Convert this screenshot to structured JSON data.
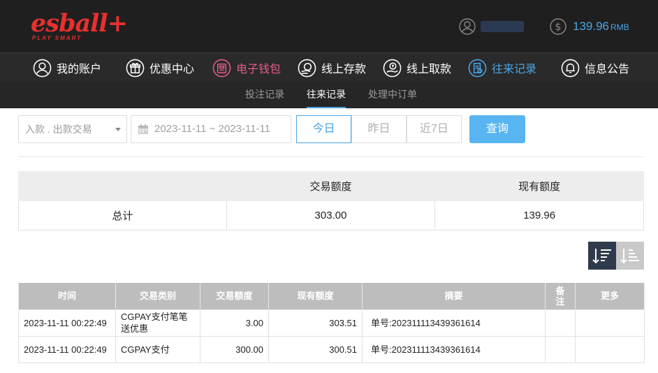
{
  "header": {
    "logo_text": "esball+",
    "logo_tagline": "PLAY SMART",
    "balance_amount": "139.96",
    "balance_unit": "RMB"
  },
  "nav": [
    {
      "label": "我的账户",
      "icon": "user-circle-icon"
    },
    {
      "label": "优惠中心",
      "icon": "gift-icon"
    },
    {
      "label": "电子钱包",
      "icon": "wallet-icon"
    },
    {
      "label": "线上存款",
      "icon": "deposit-icon"
    },
    {
      "label": "线上取款",
      "icon": "withdraw-icon"
    },
    {
      "label": "往来记录",
      "icon": "records-icon"
    },
    {
      "label": "信息公告",
      "icon": "bell-icon"
    }
  ],
  "subnav": [
    {
      "label": "投注记录"
    },
    {
      "label": "往来记录"
    },
    {
      "label": "处理中订单"
    }
  ],
  "filters": {
    "type_select": "入款 . 出款交易",
    "date_range": "2023-11-11 ~ 2023-11-11",
    "quick_ranges": [
      "今日",
      "昨日",
      "近7日"
    ],
    "query_label": "查询"
  },
  "summary": {
    "headers": [
      "",
      "交易额度",
      "现有额度"
    ],
    "row": [
      "总计",
      "303.00",
      "139.96"
    ]
  },
  "records": {
    "headers": [
      "时间",
      "交易类别",
      "交易额度",
      "现有额度",
      "摘要",
      "备注",
      "更多"
    ],
    "rows": [
      [
        "2023-11-11 00:22:49",
        "CGPAY支付笔笔送优惠",
        "3.00",
        "303.51",
        "单号:202311113439361614",
        "",
        ""
      ],
      [
        "2023-11-11 00:22:49",
        "CGPAY支付",
        "300.00",
        "300.51",
        "单号:202311113439361614",
        "",
        ""
      ]
    ]
  },
  "colors": {
    "accent": "#4aa5e6",
    "brand_red": "#e8302f",
    "wallet_pink": "#e65a8c",
    "header_bg": "#1f1f1f"
  }
}
